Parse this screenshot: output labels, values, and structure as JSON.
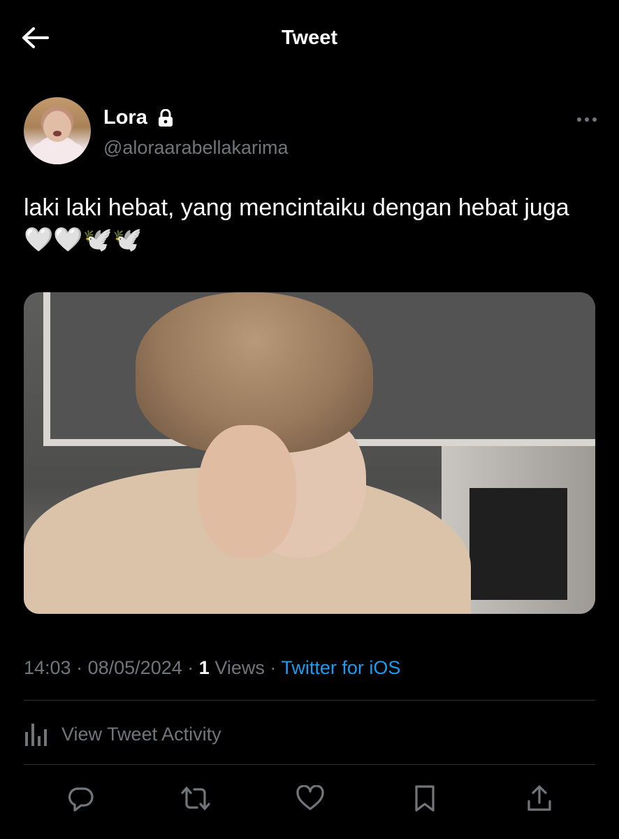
{
  "header": {
    "title": "Tweet",
    "back_icon": "arrow-left-icon"
  },
  "author": {
    "name": "Lora",
    "handle": "@aloraarabellakarima",
    "protected_icon": "lock-icon"
  },
  "tweet": {
    "text": "laki laki hebat, yang mencintaiku dengan hebat juga🤍🤍🕊️🕊️"
  },
  "meta": {
    "time": "14:03",
    "date": "08/05/2024",
    "views_count": "1",
    "views_label": "Views",
    "source": "Twitter for iOS",
    "separator": "·"
  },
  "activity": {
    "label": "View Tweet Activity",
    "icon": "analytics-icon"
  },
  "actions": [
    "reply-icon",
    "retweet-icon",
    "like-icon",
    "bookmark-icon",
    "share-icon"
  ],
  "colors": {
    "background": "#000000",
    "text": "#e7e9ea",
    "muted": "#71767b",
    "accent": "#1d9bf0",
    "divider": "#2f3336"
  }
}
